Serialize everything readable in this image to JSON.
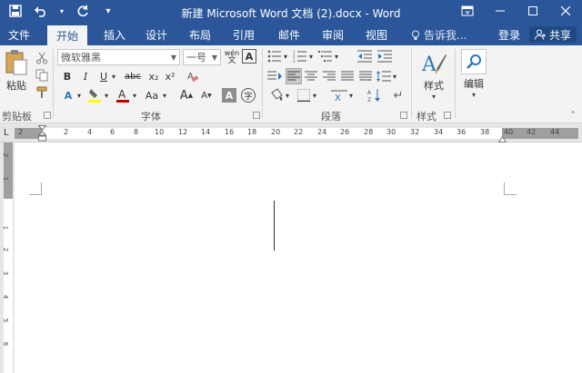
{
  "window": {
    "title": "新建 Microsoft Word 文档 (2).docx - Word",
    "controls": [
      "restore-icon",
      "minimize-icon",
      "maximize-icon",
      "close-icon"
    ]
  },
  "qat": {
    "icons": [
      "save-icon",
      "undo-icon",
      "redo-icon",
      "customize-icon"
    ]
  },
  "tabs": [
    {
      "label": "文件"
    },
    {
      "label": "开始"
    },
    {
      "label": "插入"
    },
    {
      "label": "设计"
    },
    {
      "label": "布局"
    },
    {
      "label": "引用"
    },
    {
      "label": "邮件"
    },
    {
      "label": "审阅"
    },
    {
      "label": "视图"
    }
  ],
  "tell": {
    "text": "告诉我..."
  },
  "account": {
    "login": "登录",
    "share": "共享"
  },
  "clipboard": {
    "paste_label": "粘贴",
    "group_label": "剪贴板"
  },
  "font": {
    "name_value": "微软雅黑",
    "size_value": "一号",
    "group_label": "字体",
    "bold": "B",
    "italic": "I",
    "underline": "U",
    "strike": "abc",
    "sub": "x₂",
    "sup": "x²",
    "grow": "A",
    "shrink": "A",
    "case": "Aa",
    "clear": "A",
    "char_border": "A",
    "enclose": "字",
    "pinyin": "wén"
  },
  "paragraph": {
    "group_label": "段落"
  },
  "styles": {
    "label": "样式",
    "group_label": "样式"
  },
  "editing": {
    "label": "编辑"
  },
  "ruler": {
    "numbers": [
      "2",
      "2",
      "4",
      "6",
      "8",
      "10",
      "12",
      "14",
      "16",
      "18",
      "20",
      "22",
      "24",
      "26",
      "28",
      "30",
      "32",
      "34",
      "36",
      "38",
      "40",
      "42",
      "44"
    ],
    "vnumbers": [
      "2",
      "1",
      "1",
      "2",
      "3",
      "4",
      "5",
      "6"
    ],
    "corner": "L"
  },
  "colors": {
    "accent": "#2b579a",
    "ribbon": "#f3f3f3",
    "highlight": "#ffff00",
    "font_color": "#c00000"
  }
}
